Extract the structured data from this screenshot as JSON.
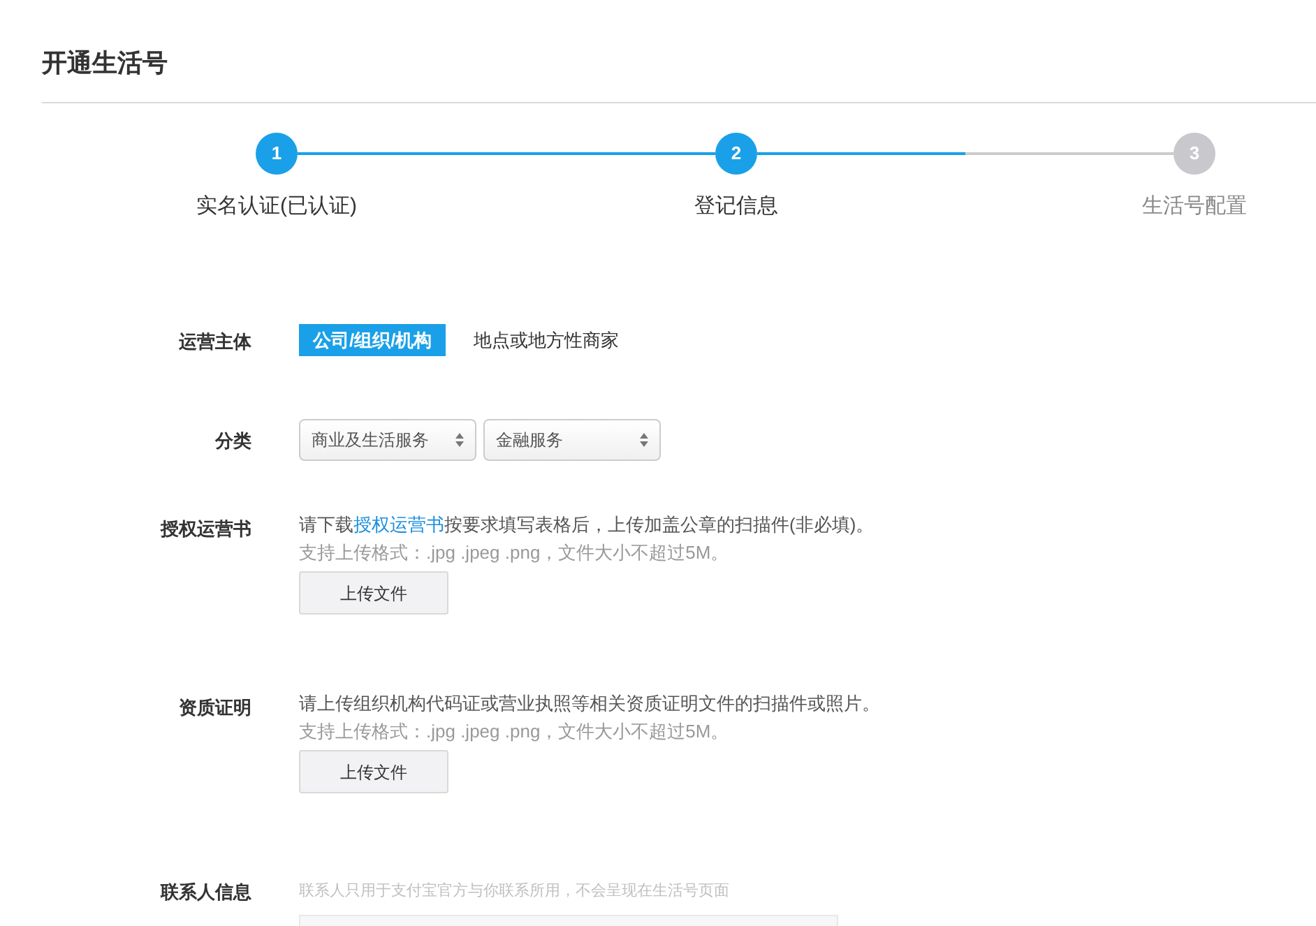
{
  "page_title": "开通生活号",
  "steps": [
    {
      "number": "1",
      "label": "实名认证(已认证)",
      "reached": true
    },
    {
      "number": "2",
      "label": "登记信息",
      "reached": true
    },
    {
      "number": "3",
      "label": "生活号配置",
      "reached": false
    }
  ],
  "connectors": [
    {
      "level": 1
    },
    {
      "level": 0.5
    }
  ],
  "form": [
    {
      "kind": "choice",
      "label": "运营主体",
      "options": [
        {
          "label": "公司/组织/机构",
          "selected": true
        },
        {
          "label": "地点或地方性商家",
          "selected": false
        }
      ]
    },
    {
      "kind": "selects",
      "label": "分类",
      "selects": [
        {
          "value": "商业及生活服务"
        },
        {
          "value": "金融服务"
        }
      ]
    },
    {
      "kind": "upload",
      "label": "授权运营书",
      "text_before": "请下载",
      "link": "授权运营书",
      "text_after": "按要求填写表格后，上传加盖公章的扫描件(非必填)。",
      "hint": "支持上传格式：.jpg .jpeg .png，文件大小不超过5M。",
      "button": "上传文件"
    },
    {
      "kind": "upload",
      "label": "资质证明",
      "text_before": "请上传组织机构代码证或营业执照等相关资质证明文件的扫描件或照片。",
      "hint": "支持上传格式：.jpg .jpeg .png，文件大小不超过5M。",
      "button": "上传文件"
    },
    {
      "kind": "contact",
      "label": "联系人信息",
      "note": "联系人只用于支付宝官方与你联系所用，不会呈现在生活号页面"
    }
  ]
}
